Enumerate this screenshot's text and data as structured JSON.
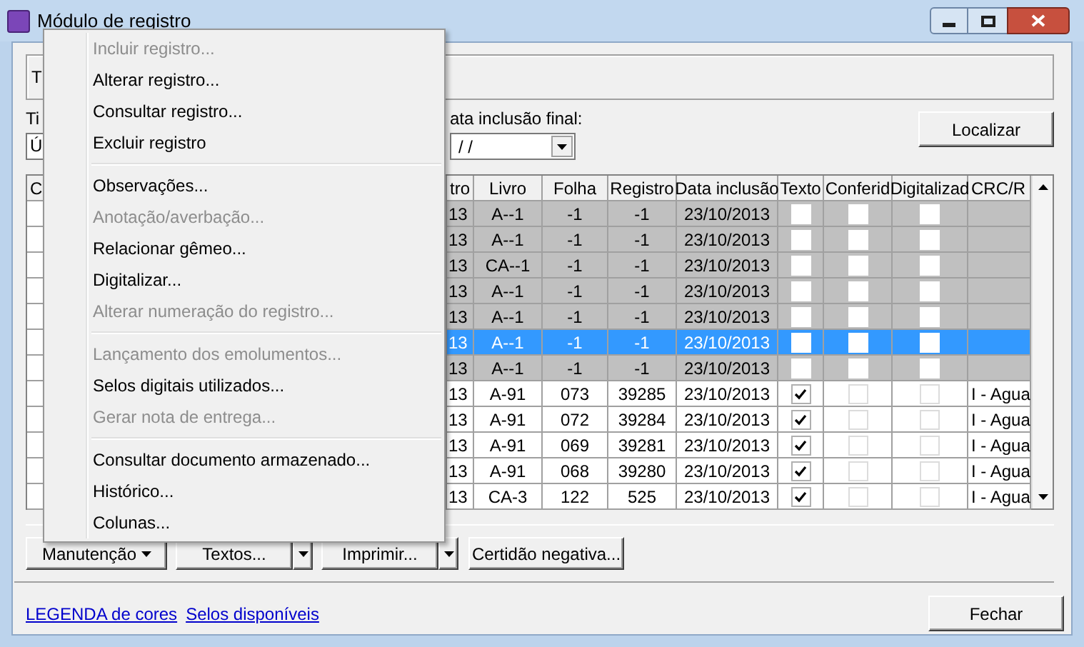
{
  "window": {
    "title": "Módulo de registro"
  },
  "filter_box": {
    "text": "T"
  },
  "type_field": {
    "label": "Ti",
    "value": "Ú"
  },
  "date_field": {
    "label": "ata inclusão final:",
    "value": "/ /"
  },
  "search_button": "Localizar",
  "table": {
    "columns": [
      {
        "label": "C"
      },
      {
        "label": "tro"
      },
      {
        "label": "Livro"
      },
      {
        "label": "Folha"
      },
      {
        "label": "Registro"
      },
      {
        "label": "Data inclusão"
      },
      {
        "label": "Texto"
      },
      {
        "label": "Conferid"
      },
      {
        "label": "Digitalizad"
      },
      {
        "label": "CRC/R"
      }
    ],
    "rows": [
      {
        "shaded": true,
        "selected": false,
        "cells": [
          "",
          "13",
          "A--1",
          "-1",
          "-1",
          "23/10/2013"
        ],
        "checks": [
          false,
          false,
          false
        ]
      },
      {
        "shaded": true,
        "selected": false,
        "cells": [
          "",
          "13",
          "A--1",
          "-1",
          "-1",
          "23/10/2013"
        ],
        "checks": [
          false,
          false,
          false
        ]
      },
      {
        "shaded": true,
        "selected": false,
        "cells": [
          "",
          "13",
          "CA--1",
          "-1",
          "-1",
          "23/10/2013"
        ],
        "checks": [
          false,
          false,
          false
        ]
      },
      {
        "shaded": true,
        "selected": false,
        "cells": [
          "",
          "13",
          "A--1",
          "-1",
          "-1",
          "23/10/2013"
        ],
        "checks": [
          false,
          false,
          false
        ]
      },
      {
        "shaded": true,
        "selected": false,
        "cells": [
          "",
          "13",
          "A--1",
          "-1",
          "-1",
          "23/10/2013"
        ],
        "checks": [
          false,
          false,
          false
        ]
      },
      {
        "shaded": true,
        "selected": true,
        "cells": [
          "",
          "13",
          "A--1",
          "-1",
          "-1",
          "23/10/2013"
        ],
        "checks": [
          false,
          false,
          false
        ]
      },
      {
        "shaded": true,
        "selected": false,
        "cells": [
          "",
          "13",
          "A--1",
          "-1",
          "-1",
          "23/10/2013"
        ],
        "checks": [
          false,
          false,
          false
        ]
      },
      {
        "shaded": false,
        "selected": false,
        "cells": [
          "",
          "13",
          "A-91",
          "073",
          "39285",
          "23/10/2013"
        ],
        "checks": [
          true,
          false,
          false
        ],
        "crc": "I - Agua"
      },
      {
        "shaded": false,
        "selected": false,
        "cells": [
          "",
          "13",
          "A-91",
          "072",
          "39284",
          "23/10/2013"
        ],
        "checks": [
          true,
          false,
          false
        ],
        "crc": "I - Agua"
      },
      {
        "shaded": false,
        "selected": false,
        "cells": [
          "",
          "13",
          "A-91",
          "069",
          "39281",
          "23/10/2013"
        ],
        "checks": [
          true,
          false,
          false
        ],
        "crc": "I - Agua"
      },
      {
        "shaded": false,
        "selected": false,
        "cells": [
          "",
          "13",
          "A-91",
          "068",
          "39280",
          "23/10/2013"
        ],
        "checks": [
          true,
          false,
          false
        ],
        "crc": "I - Agua"
      },
      {
        "shaded": false,
        "selected": false,
        "cells": [
          "",
          "13",
          "CA-3",
          "122",
          "525",
          "23/10/2013"
        ],
        "checks": [
          true,
          false,
          false
        ],
        "crc": "I - Agua"
      }
    ]
  },
  "context_menu": [
    {
      "kind": "item",
      "label": "Incluir registro...",
      "disabled": true
    },
    {
      "kind": "item",
      "label": "Alterar registro...",
      "disabled": false
    },
    {
      "kind": "item",
      "label": "Consultar registro...",
      "disabled": false
    },
    {
      "kind": "item",
      "label": "Excluir registro",
      "disabled": false
    },
    {
      "kind": "separator"
    },
    {
      "kind": "item",
      "label": "Observações...",
      "disabled": false
    },
    {
      "kind": "item",
      "label": "Anotação/averbação...",
      "disabled": true
    },
    {
      "kind": "item",
      "label": "Relacionar gêmeo...",
      "disabled": false
    },
    {
      "kind": "item",
      "label": "Digitalizar...",
      "disabled": false
    },
    {
      "kind": "item",
      "label": "Alterar numeração do registro...",
      "disabled": true
    },
    {
      "kind": "separator"
    },
    {
      "kind": "item",
      "label": "Lançamento dos emolumentos...",
      "disabled": true
    },
    {
      "kind": "item",
      "label": "Selos digitais utilizados...",
      "disabled": false
    },
    {
      "kind": "item",
      "label": "Gerar nota de entrega...",
      "disabled": true
    },
    {
      "kind": "separator"
    },
    {
      "kind": "item",
      "label": "Consultar documento armazenado...",
      "disabled": false
    },
    {
      "kind": "item",
      "label": "Histórico...",
      "disabled": false
    },
    {
      "kind": "item",
      "label": "Colunas...",
      "disabled": false
    }
  ],
  "action_buttons": [
    {
      "kind": "menu",
      "label": "Manutenção"
    },
    {
      "kind": "split",
      "label": "Textos..."
    },
    {
      "kind": "split",
      "label": "Imprimir..."
    },
    {
      "kind": "plain",
      "label": "Certidão negativa..."
    }
  ],
  "links": [
    "LEGENDA de cores",
    "Selos disponíveis"
  ],
  "close_button": "Fechar"
}
